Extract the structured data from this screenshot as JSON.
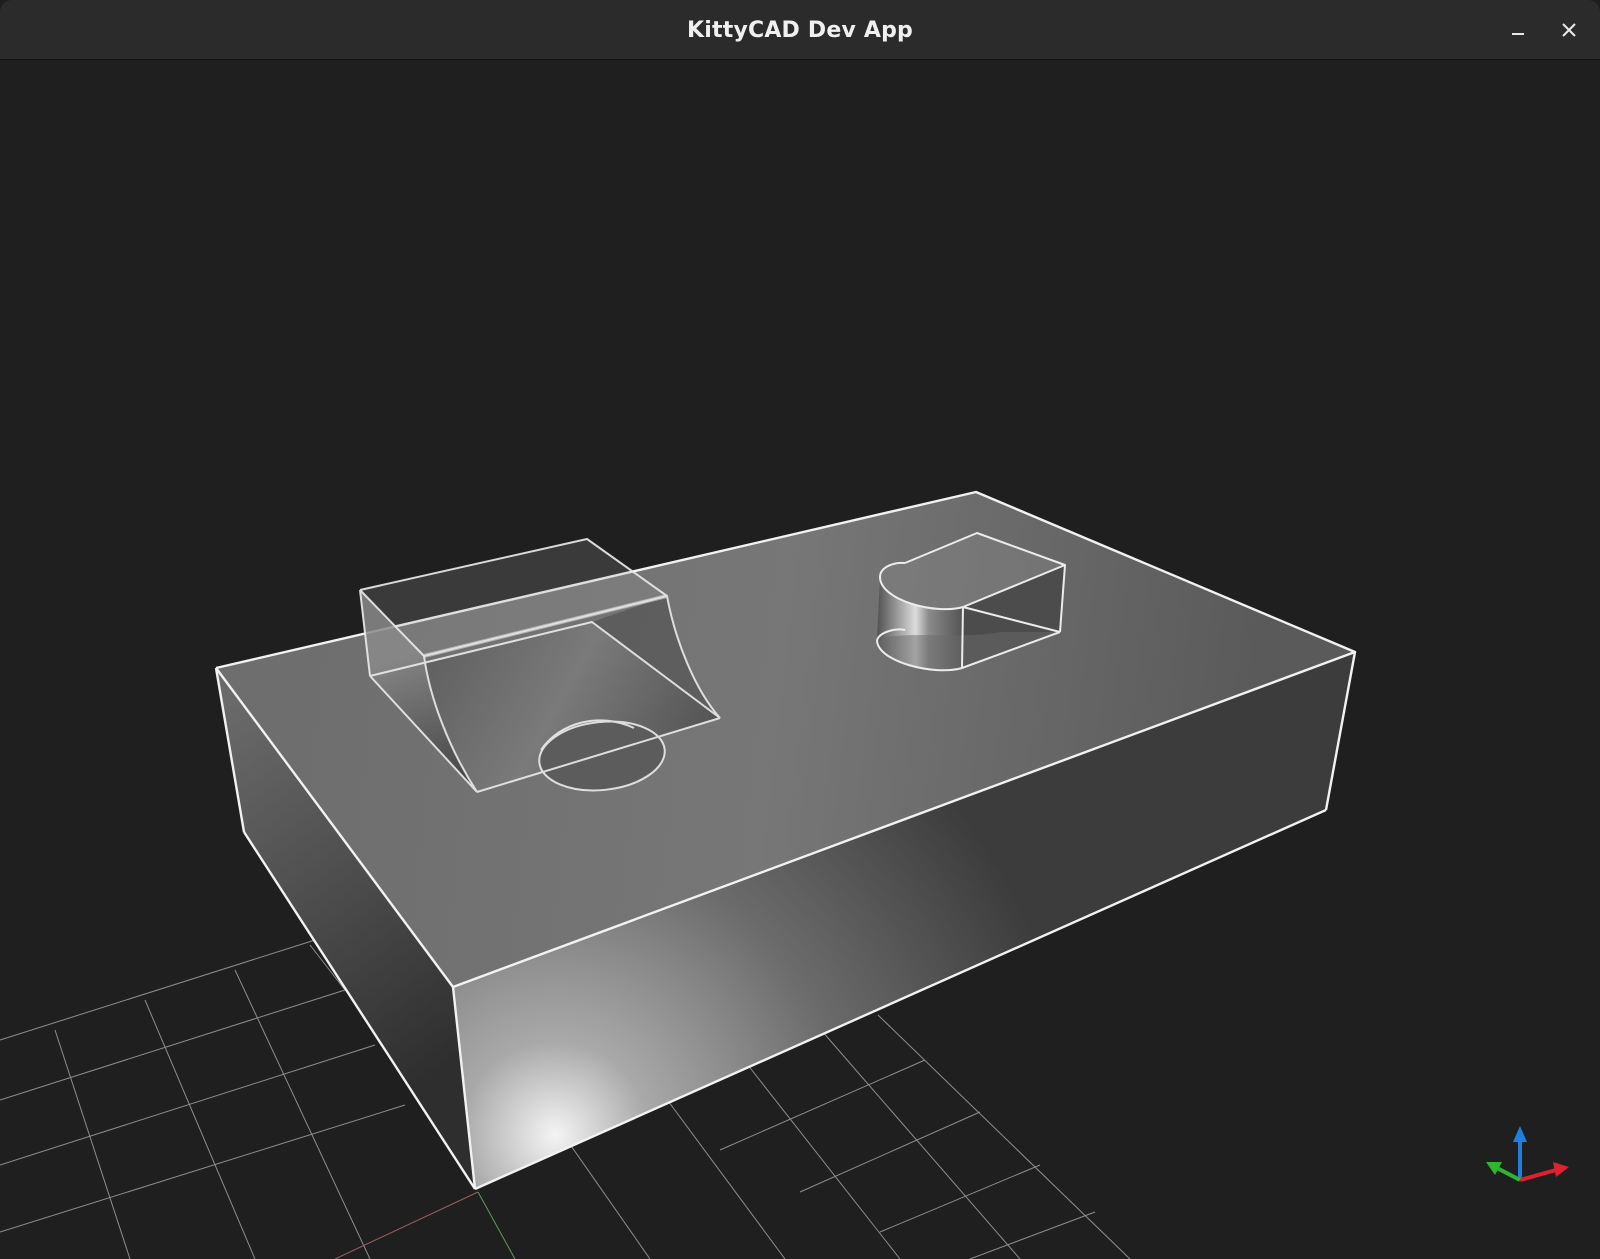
{
  "window": {
    "title": "KittyCAD Dev App",
    "controls": {
      "minimize_icon": "minimize-icon",
      "close_icon": "close-icon"
    }
  },
  "viewport": {
    "background_color": "#1f1f1f",
    "grid_color": "#bdbdbd",
    "edge_color": "#f2f2f2",
    "model_color": "#777777"
  },
  "axis_gizmo": {
    "x_color": "#e0212f",
    "y_color": "#2fb52f",
    "z_color": "#1f7fe0"
  }
}
